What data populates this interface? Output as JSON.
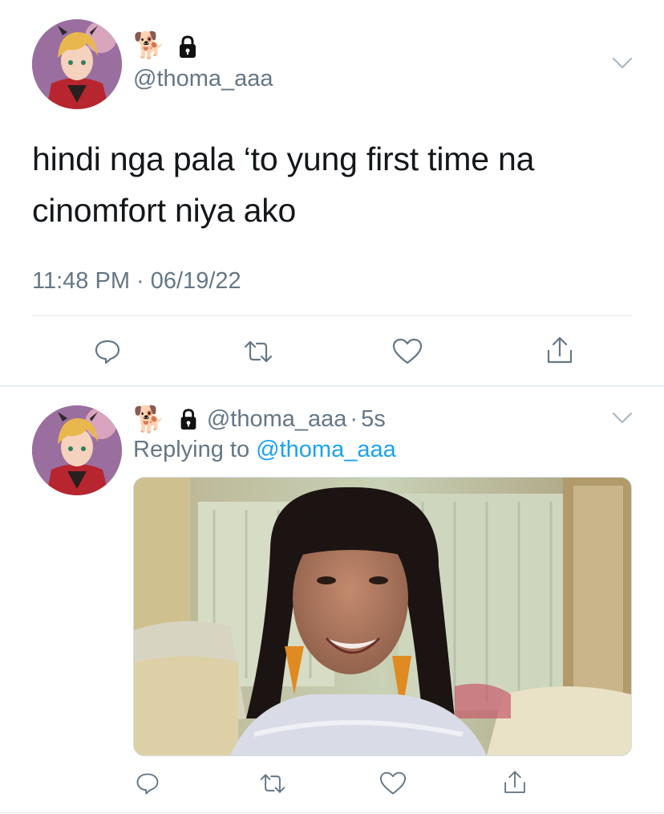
{
  "tweet": {
    "emoji": "🐕",
    "handle": "@thoma_aaa",
    "text_line1": "hindi nga pala ‘to yung first time na",
    "text_line2": "cinomfort niya ako",
    "timestamp": "11:48 PM · 06/19/22"
  },
  "reply": {
    "emoji": "🐕",
    "handle": "@thoma_aaa",
    "separator": "·",
    "age": "5s",
    "replying_prefix": "Replying to",
    "replying_to": "@thoma_aaa"
  },
  "icons": [
    "chevron-down-icon",
    "lock-icon",
    "reply-icon",
    "retweet-icon",
    "like-icon",
    "share-icon"
  ],
  "colors": {
    "accent": "#1da1f2",
    "muted": "#657786",
    "divider": "#e1e8ed"
  }
}
